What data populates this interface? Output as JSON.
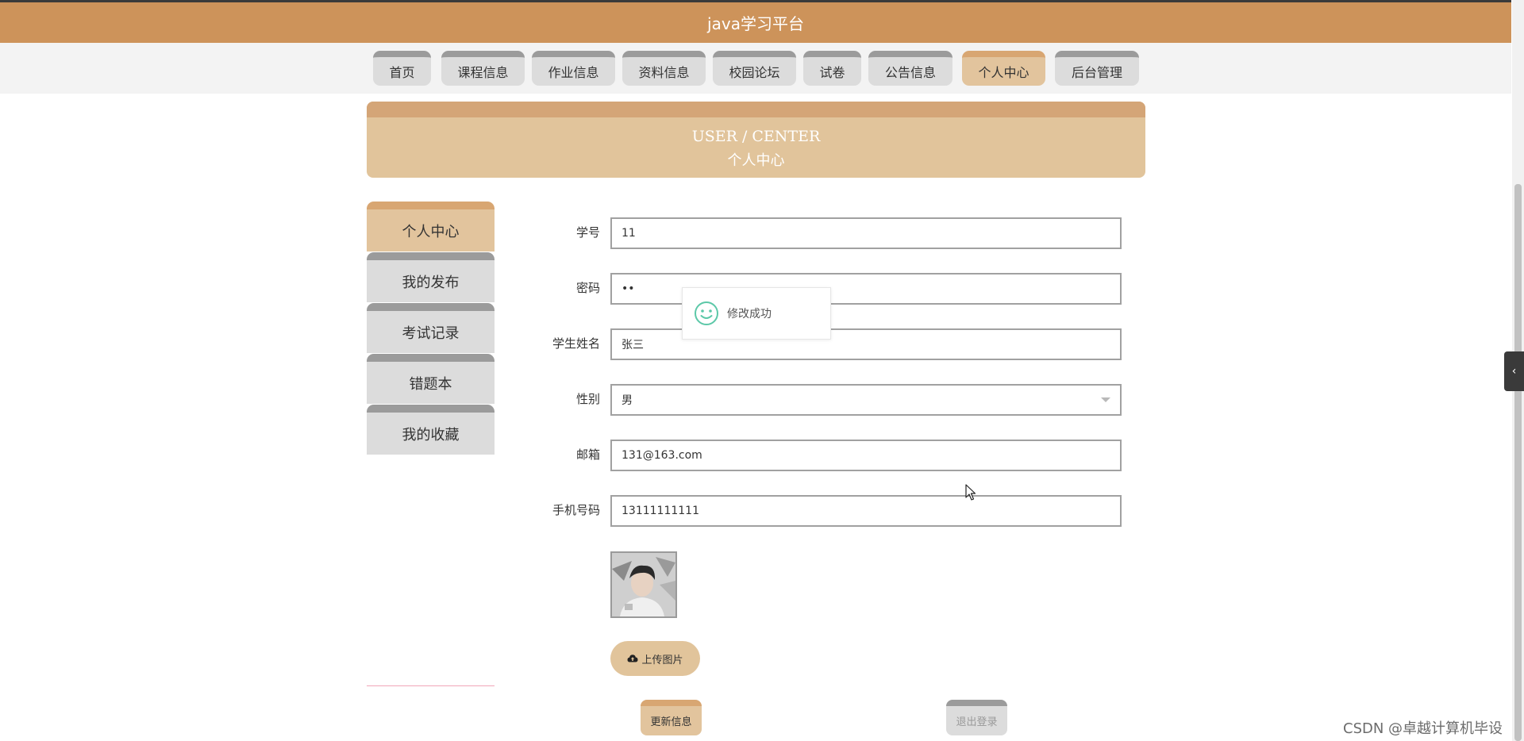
{
  "header": {
    "title": "java学习平台"
  },
  "nav": {
    "items": [
      {
        "label": "首页"
      },
      {
        "label": "课程信息"
      },
      {
        "label": "作业信息"
      },
      {
        "label": "资料信息"
      },
      {
        "label": "校园论坛"
      },
      {
        "label": "试卷"
      },
      {
        "label": "公告信息"
      },
      {
        "label": "个人中心",
        "active": true
      },
      {
        "label": "后台管理"
      }
    ]
  },
  "banner": {
    "en": "USER / CENTER",
    "cn": "个人中心"
  },
  "sidebar": {
    "items": [
      {
        "label": "个人中心",
        "active": true
      },
      {
        "label": "我的发布"
      },
      {
        "label": "考试记录"
      },
      {
        "label": "错题本"
      },
      {
        "label": "我的收藏"
      }
    ]
  },
  "form": {
    "student_id": {
      "label": "学号",
      "value": "11"
    },
    "password": {
      "label": "密码",
      "value": "••"
    },
    "name": {
      "label": "学生姓名",
      "value": "张三"
    },
    "gender": {
      "label": "性别",
      "value": "男"
    },
    "email": {
      "label": "邮箱",
      "value": "131@163.com"
    },
    "phone": {
      "label": "手机号码",
      "value": "13111111111"
    },
    "upload_label": "上传图片"
  },
  "actions": {
    "update_label": "更新信息",
    "logout_label": "退出登录"
  },
  "toast": {
    "message": "修改成功"
  },
  "watermark": "CSDN @卓越计算机毕设",
  "icons": {
    "toast": "smile-icon",
    "upload": "cloud-upload-icon",
    "side_tab": "chevron-left-icon",
    "select": "caret-down-icon"
  },
  "colors": {
    "header": "#cd935a",
    "accent": "#e2c49d",
    "accent_top": "#d8a672",
    "tab_gray": "#dcdcdc",
    "tab_gray_top": "#9b9b9b",
    "toast_icon": "#5cc8a8"
  }
}
